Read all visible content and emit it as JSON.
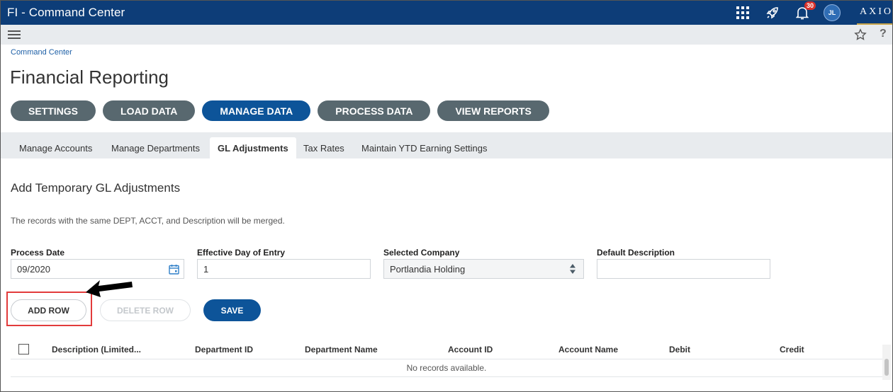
{
  "app": {
    "title": "FI - Command Center",
    "notification_count": "30",
    "user_initials": "JL",
    "brand": "AXIOM"
  },
  "breadcrumb": "Command Center",
  "page_title": "Financial Reporting",
  "nav_pills": [
    {
      "label": "SETTINGS",
      "active": false
    },
    {
      "label": "LOAD DATA",
      "active": false
    },
    {
      "label": "MANAGE DATA",
      "active": true
    },
    {
      "label": "PROCESS DATA",
      "active": false
    },
    {
      "label": "VIEW REPORTS",
      "active": false
    }
  ],
  "tabs": [
    {
      "label": "Manage Accounts"
    },
    {
      "label": "Manage Departments"
    },
    {
      "label": "GL Adjustments",
      "active": true
    },
    {
      "label": "Tax Rates"
    },
    {
      "label": "Maintain YTD Earning Settings"
    }
  ],
  "section_title": "Add Temporary GL Adjustments",
  "info_text": "The records with the same DEPT, ACCT, and Description will be merged.",
  "form": {
    "process_date": {
      "label": "Process Date",
      "value": "09/2020"
    },
    "effective_day": {
      "label": "Effective Day of Entry",
      "value": "1"
    },
    "company": {
      "label": "Selected Company",
      "value": "Portlandia Holding"
    },
    "default_description": {
      "label": "Default Description",
      "value": ""
    }
  },
  "buttons": {
    "add_row": "ADD ROW",
    "delete_row": "DELETE ROW",
    "save": "SAVE"
  },
  "grid": {
    "columns": [
      "Description (Limited...",
      "Department ID",
      "Department Name",
      "Account ID",
      "Account Name",
      "Debit",
      "Credit"
    ],
    "empty_text": "No records available."
  },
  "colors": {
    "header": "#0d3d78",
    "accent": "#0d5499",
    "pill": "#58686f",
    "highlight": "#e23b3b"
  }
}
